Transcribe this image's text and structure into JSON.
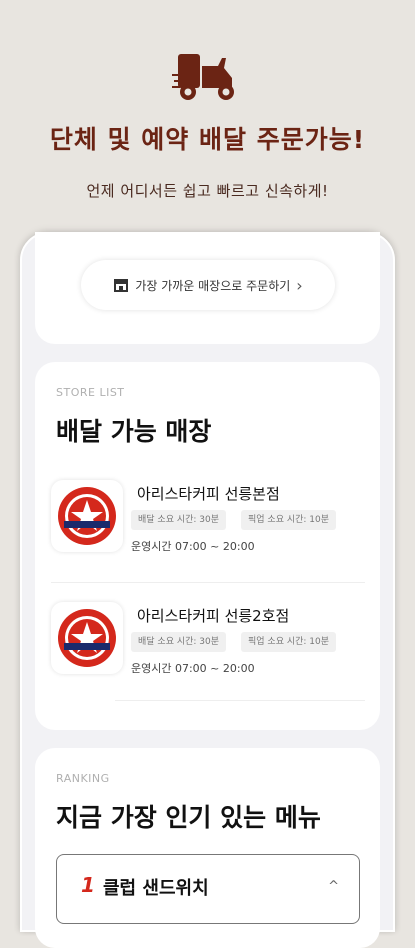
{
  "hero": {
    "headline": "단체 및 예약 배달 주문가능!",
    "subline": "언제 어디서든 쉽고 빠르고 신속하게!",
    "icon": "delivery-scooter-icon",
    "brand_color": "#6b2414"
  },
  "nearest": {
    "label": "가장 가까운 매장으로 주문하기",
    "icon": "store-icon",
    "chevron": "›"
  },
  "stores_section": {
    "label": "STORE LIST",
    "title": "배달 가능 매장",
    "stores": [
      {
        "name": "아리스타커피 선릉본점",
        "delivery_time": "배달 소요 시간: 30분",
        "pickup_time": "픽업 소요 시간: 10분",
        "hours": "운영시간 07:00 ~ 20:00"
      },
      {
        "name": "아리스타커피 선릉2호점",
        "delivery_time": "배달 소요 시간: 30분",
        "pickup_time": "픽업 소요 시간: 10분",
        "hours": "운영시간 07:00 ~ 20:00"
      }
    ]
  },
  "ranking_section": {
    "label": "RANKING",
    "title": "지금 가장 인기 있는 메뉴",
    "items": [
      {
        "rank": "1",
        "name": "클럽 샌드위치",
        "chevron": "^"
      }
    ],
    "accent": "#d4281c"
  }
}
